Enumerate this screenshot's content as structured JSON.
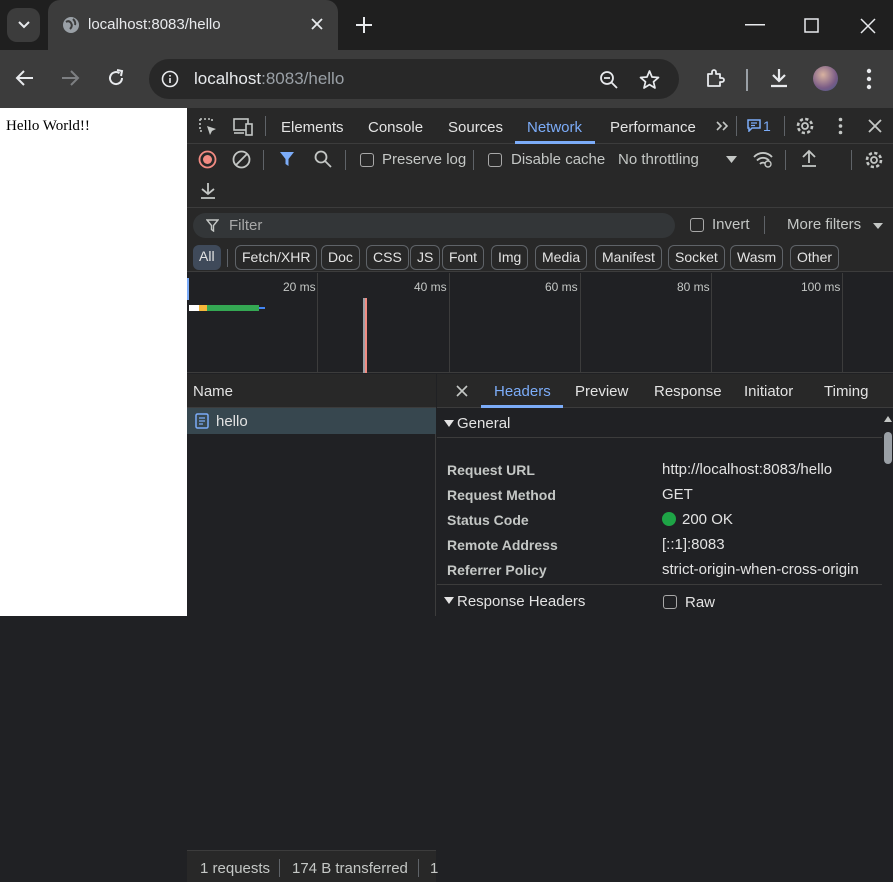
{
  "browser": {
    "tab_title": "localhost:8083/hello",
    "url_host": "localhost",
    "url_rest": ":8083/hello"
  },
  "page": {
    "text": "Hello World!!"
  },
  "devtools": {
    "tabs": [
      "Elements",
      "Console",
      "Sources",
      "Network",
      "Performance"
    ],
    "issues_count": "1",
    "toolbar": {
      "preserve_log": "Preserve log",
      "disable_cache": "Disable cache",
      "throttling": "No throttling"
    },
    "filter": {
      "placeholder": "Filter",
      "invert": "Invert",
      "more_filters": "More filters"
    },
    "type_filters": [
      "All",
      "Fetch/XHR",
      "Doc",
      "CSS",
      "JS",
      "Font",
      "Img",
      "Media",
      "Manifest",
      "Socket",
      "Wasm",
      "Other"
    ],
    "timeline_labels": [
      "20 ms",
      "40 ms",
      "60 ms",
      "80 ms",
      "100 ms"
    ],
    "requests": {
      "column_name": "Name",
      "items": [
        {
          "name": "hello"
        }
      ]
    },
    "status": {
      "requests": "1 requests",
      "transferred": "174 B transferred",
      "more": "1"
    },
    "details": {
      "tabs": [
        "Headers",
        "Preview",
        "Response",
        "Initiator",
        "Timing"
      ],
      "general_title": "General",
      "general": [
        {
          "key": "Request URL",
          "value": "http://localhost:8083/hello"
        },
        {
          "key": "Request Method",
          "value": "GET"
        },
        {
          "key": "Status Code",
          "value": "200 OK"
        },
        {
          "key": "Remote Address",
          "value": "[::1]:8083"
        },
        {
          "key": "Referrer Policy",
          "value": "strict-origin-when-cross-origin"
        }
      ],
      "response_headers_title": "Response Headers",
      "raw_label": "Raw"
    }
  },
  "colors": {
    "accent": "#7cacf8",
    "status_ok": "#1ea446",
    "record_red": "#f28b82",
    "filter_blue": "#7cacf8"
  },
  "icons": [
    "tab-search-icon",
    "globe-icon",
    "close-icon",
    "plus-icon",
    "minimize-icon",
    "maximize-icon",
    "back-icon",
    "forward-icon",
    "reload-icon",
    "site-info-icon",
    "zoom-icon",
    "star-icon",
    "extensions-icon",
    "download-icon",
    "kebab-menu-icon",
    "inspect-icon",
    "device-icon",
    "issues-icon",
    "settings-icon",
    "record-icon",
    "clear-icon",
    "funnel-icon",
    "search-icon",
    "network-conditions-icon",
    "upload-icon",
    "document-icon"
  ]
}
